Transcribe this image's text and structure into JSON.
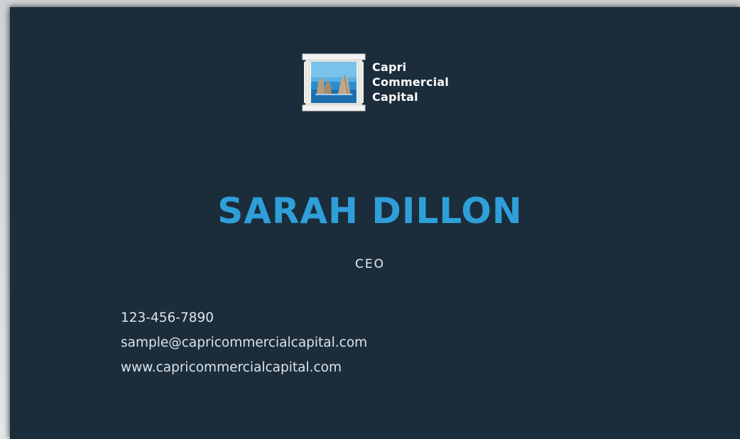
{
  "brand": {
    "line1": "Capri",
    "line2": "Commercial",
    "line3": "Capital"
  },
  "person": {
    "name": "SARAH DILLON",
    "title": "CEO"
  },
  "contact": {
    "phone": "123-456-7890",
    "email": "sample@capricommercialcapital.com",
    "website": "www.capricommercialcapital.com"
  },
  "colors": {
    "card_background": "#1b2d3b",
    "name_accent": "#2f9fd9",
    "text": "#dfe4e8"
  },
  "icons": [
    "column-frame-logo-icon"
  ]
}
